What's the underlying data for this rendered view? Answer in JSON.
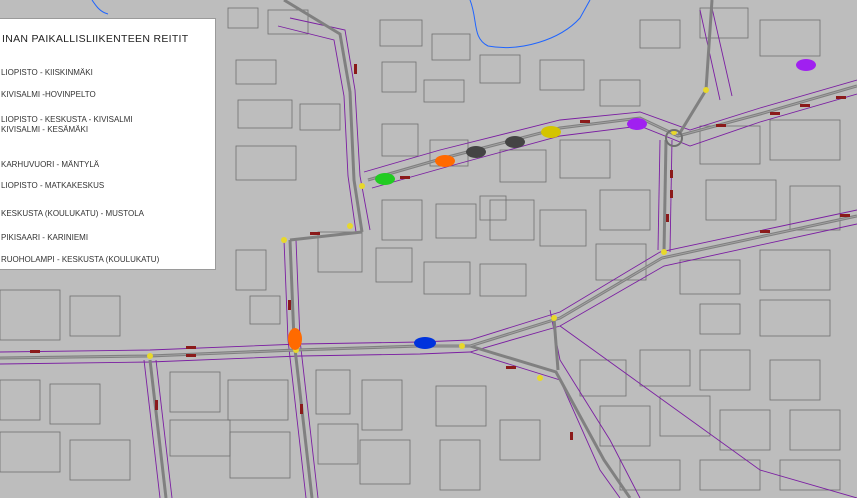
{
  "legend": {
    "title": "INAN PAIKALLISLIIKENTEEN REITIT",
    "routes": [
      {
        "lines": [
          "LIOPISTO - KIISKINMÄKI"
        ]
      },
      {
        "lines": [
          "KIVISALMI -HOVINPELTO"
        ]
      },
      {
        "lines": [
          "LIOPISTO - KESKUSTA - KIVISALMI",
          "KIVISALMI - KESÄMÄKI"
        ]
      },
      {
        "lines": [
          "KARHUVUORI - MÄNTYLÄ"
        ]
      },
      {
        "lines": [
          "LIOPISTO - MATKAKESKUS"
        ]
      },
      {
        "lines": [
          "KESKUSTA (KOULUKATU) - MUSTOLA"
        ]
      },
      {
        "lines": [
          "PIKISAARI - KARINIEMI"
        ]
      },
      {
        "lines": [
          "RUOHOLAMPI - KESKUSTA (KOULUKATU)"
        ]
      }
    ]
  },
  "colors": {
    "background": "#bdbdbd",
    "block_outline": "#6f6f6f",
    "street_outline": "#7b1fa2",
    "road": "#808080",
    "water": "#1e64ff",
    "stop_marker": "#8b1a1a",
    "junction_marker": "#e8d82a"
  },
  "map_markers": [
    {
      "name": "purple-bus-marker-ne",
      "color": "#a020f0"
    },
    {
      "name": "purple-bus-marker-roundabout",
      "color": "#a020f0"
    },
    {
      "name": "yellow-bus-marker",
      "color": "#d4c400"
    },
    {
      "name": "dark-grey-bus-marker-1",
      "color": "#444444"
    },
    {
      "name": "dark-grey-bus-marker-2",
      "color": "#444444"
    },
    {
      "name": "orange-bus-marker-north",
      "color": "#ff6a00"
    },
    {
      "name": "green-bus-marker",
      "color": "#22cc22"
    },
    {
      "name": "orange-bus-marker-west",
      "color": "#ff6a00"
    },
    {
      "name": "blue-bus-marker",
      "color": "#0033dd"
    }
  ]
}
